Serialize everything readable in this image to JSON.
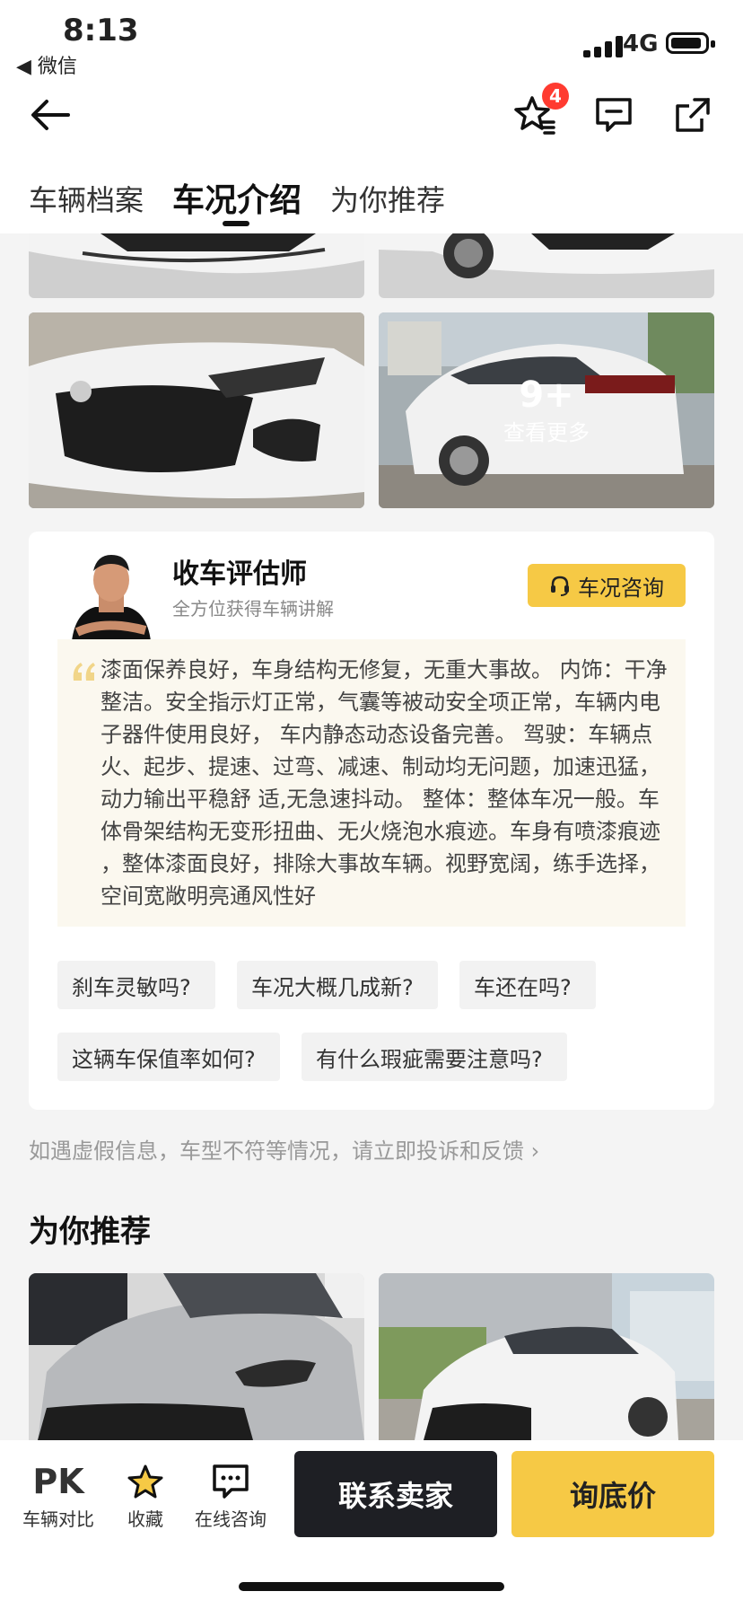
{
  "status_bar": {
    "time": "8:13",
    "back_app": "◀ 微信",
    "network": "4G"
  },
  "toolbar": {
    "badge_count": "4",
    "icons": [
      "back-arrow-icon",
      "favorite-list-icon",
      "message-icon",
      "share-icon"
    ]
  },
  "tabs": [
    {
      "label": "车辆档案",
      "active": false
    },
    {
      "label": "车况介绍",
      "active": true
    },
    {
      "label": "为你推荐",
      "active": false
    }
  ],
  "gallery": {
    "more_count": "9+",
    "more_label": "查看更多"
  },
  "evaluator": {
    "title": "收车评估师",
    "subtitle": "全方位获得车辆讲解",
    "consult_button": "车况咨询",
    "description_lines": [
      "漆面保养良好，车身结构无修复，无重大事故。 内饰：干净",
      "整洁。安全指示灯正常，气囊等被动安全项正常，车辆内电",
      "子器件使用良好， 车内静态动态设备完善。 驾驶：车辆点",
      "火、起步、提速、过弯、减速、制动均无问题，加速迅猛，",
      "动力输出平稳舒 适,无急速抖动。 整体：整体车况一般。车",
      "体骨架结构无变形扭曲、无火烧泡水痕迹。车身有喷漆痕迹",
      "，整体漆面良好，排除大事故车辆。视野宽阔，练手选择，",
      "空间宽敞明亮通风性好"
    ],
    "questions": [
      "刹车灵敏吗?",
      "车况大概几成新?",
      "车还在吗?",
      "这辆车保值率如何?",
      "有什么瑕疵需要注意吗?"
    ]
  },
  "report_text": "如遇虚假信息，车型不符等情况，请立即投诉和反馈 ›",
  "recommend": {
    "title": "为你推荐"
  },
  "bottom": {
    "pk_label": "PK",
    "compare": "车辆对比",
    "favorite": "收藏",
    "online": "在线咨询",
    "contact_seller": "联系卖家",
    "ask_price": "询底价"
  },
  "colors": {
    "accent_yellow": "#f6c945",
    "dark_button": "#1e1f24",
    "badge_red": "#ff3b30"
  }
}
